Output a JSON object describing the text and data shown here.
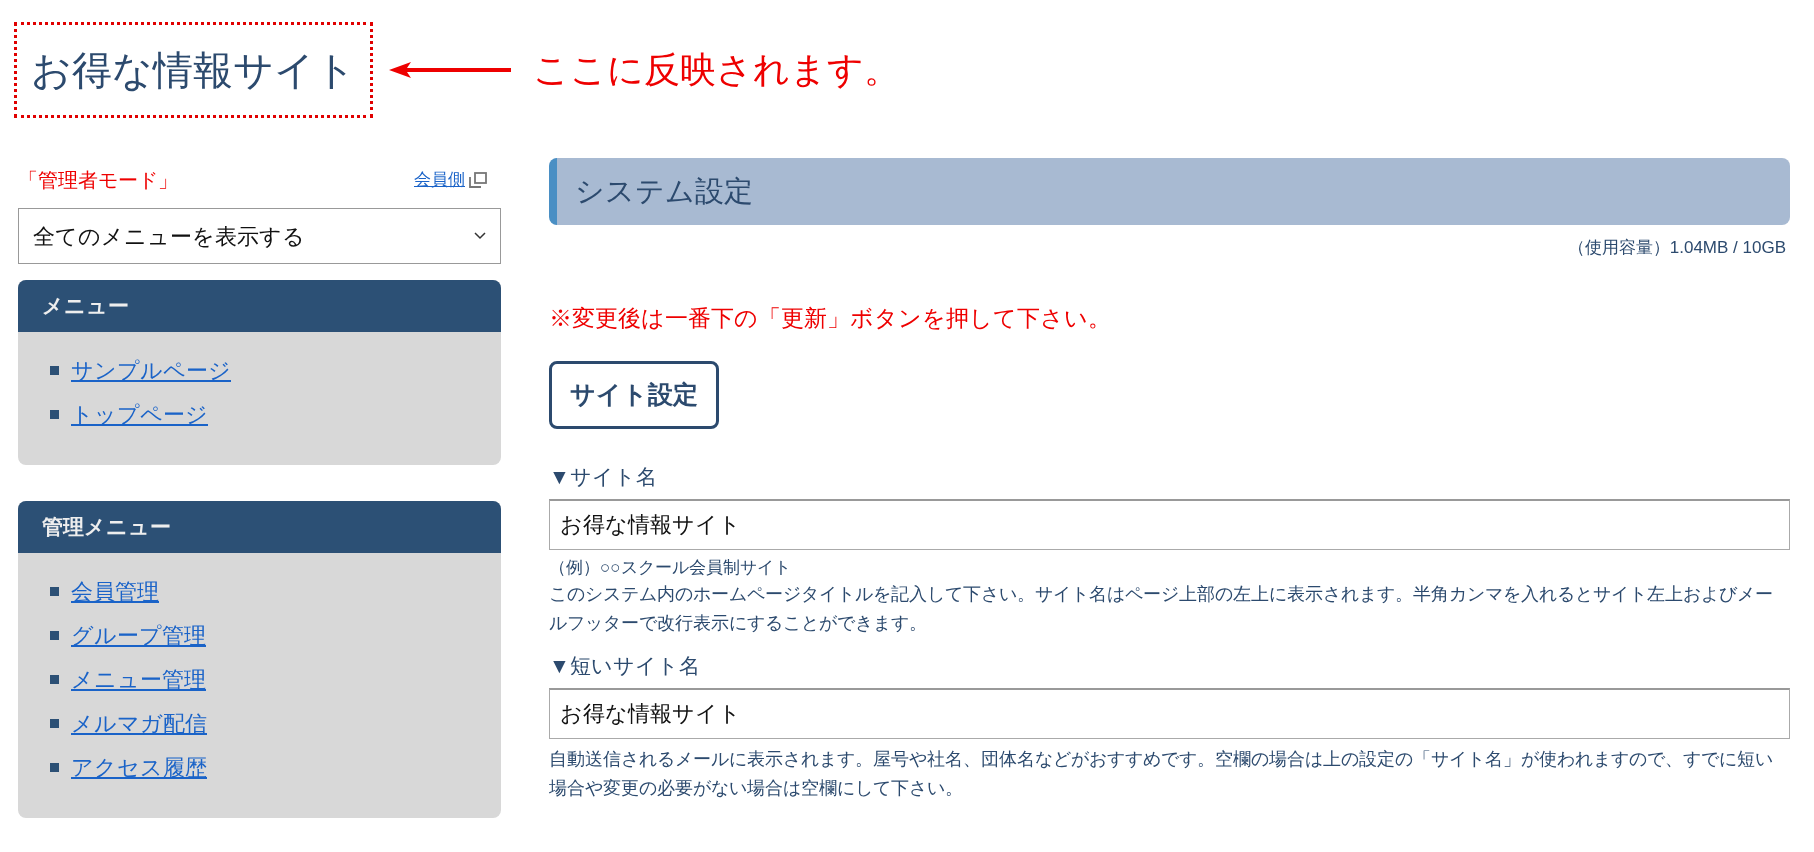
{
  "site_title": "お得な情報サイト",
  "annotation": {
    "text": "ここに反映されます。"
  },
  "sidebar": {
    "mode_label": "「管理者モード」",
    "member_link": "会員側",
    "view_select": {
      "value": "全てのメニューを表示する"
    },
    "menus": [
      {
        "title": "メニュー",
        "items": [
          "サンプルページ",
          "トップページ"
        ]
      },
      {
        "title": "管理メニュー",
        "items": [
          "会員管理",
          "グループ管理",
          "メニュー管理",
          "メルマガ配信",
          "アクセス履歴"
        ]
      }
    ]
  },
  "main": {
    "heading": "システム設定",
    "usage": "（使用容量）1.04MB / 10GB",
    "notice": "※変更後は一番下の「更新」ボタンを押して下さい。",
    "section_button": "サイト設定",
    "fields": [
      {
        "label": "▼サイト名",
        "value": "お得な情報サイト",
        "example": "（例）○○スクール会員制サイト",
        "help": "このシステム内のホームページタイトルを記入して下さい。サイト名はページ上部の左上に表示されます。半角カンマを入れるとサイト左上およびメールフッターで改行表示にすることができます。"
      },
      {
        "label": "▼短いサイト名",
        "value": "お得な情報サイト",
        "help": "自動送信されるメールに表示されます。屋号や社名、団体名などがおすすめです。空欄の場合は上の設定の「サイト名」が使われますので、すでに短い場合や変更の必要がない場合は空欄にして下さい。"
      }
    ]
  }
}
